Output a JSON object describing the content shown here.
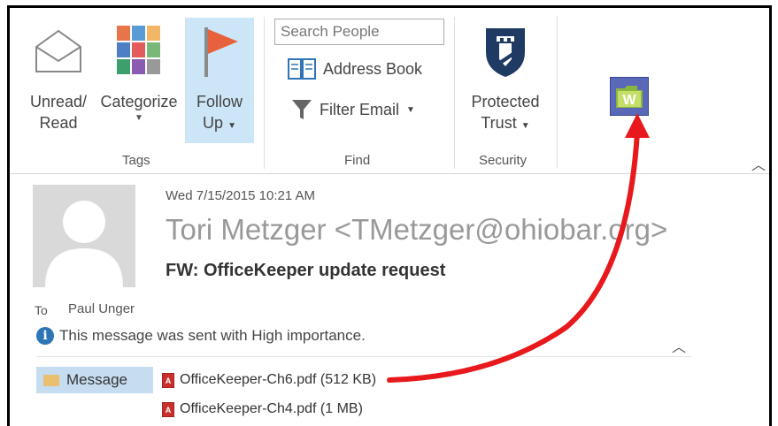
{
  "ribbon": {
    "tags": {
      "unread_read_line1": "Unread/",
      "unread_read_line2": "Read",
      "categorize": "Categorize",
      "follow_up_line1": "Follow",
      "follow_up_line2": "Up",
      "group_label": "Tags"
    },
    "find": {
      "search_placeholder": "Search People",
      "address_book": "Address Book",
      "filter_email": "Filter Email",
      "group_label": "Find"
    },
    "security": {
      "protected_line1": "Protected",
      "protected_line2": "Trust",
      "group_label": "Security"
    },
    "addin_icon": "w-addin-icon"
  },
  "message": {
    "date": "Wed 7/15/2015 10:21 AM",
    "sender": "Tori Metzger <TMetzger@ohiobar.org>",
    "subject": "FW: OfficeKeeper update request",
    "to_label": "To",
    "to_name": "Paul Unger",
    "importance": "This message was sent with High importance.",
    "message_tab": "Message",
    "attachments": [
      {
        "name": "OfficeKeeper-Ch6.pdf (512 KB)"
      },
      {
        "name": "OfficeKeeper-Ch4.pdf (1 MB)"
      }
    ]
  },
  "colors": {
    "accent": "#cde6f7",
    "arrow": "#e8191c",
    "shield": "#1f3b63"
  }
}
